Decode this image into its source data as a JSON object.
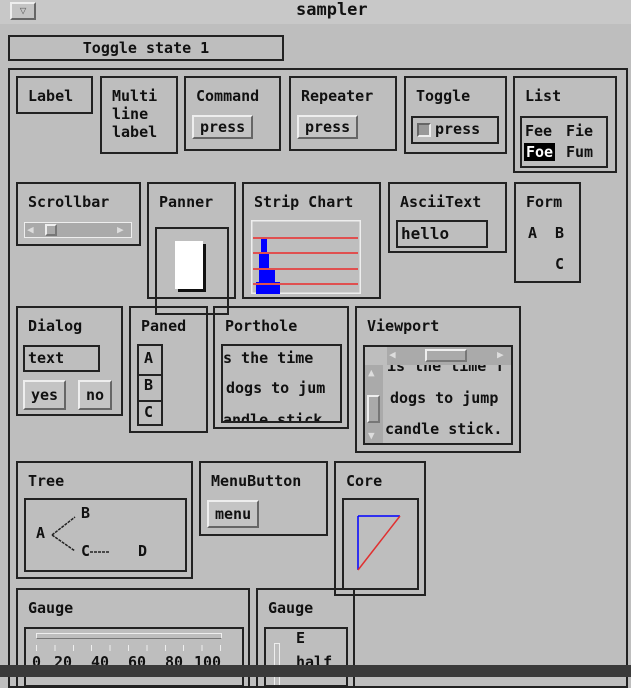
{
  "window": {
    "title": "sampler",
    "menu_icon": "triangle-down-icon"
  },
  "status_label": "Toggle state 1",
  "widgets": {
    "label": {
      "title": "Label"
    },
    "multiline": {
      "title": "Multi\nline\nlabel"
    },
    "command": {
      "title": "Command",
      "button": "press"
    },
    "repeater": {
      "title": "Repeater",
      "button": "press"
    },
    "toggle": {
      "title": "Toggle",
      "button": "press"
    },
    "list": {
      "title": "List",
      "items": [
        "Fee",
        "Fie",
        "Foe",
        "Fum"
      ],
      "selected": "Foe"
    },
    "scrollbar": {
      "title": "Scrollbar"
    },
    "panner": {
      "title": "Panner"
    },
    "stripchart": {
      "title": "Strip Chart"
    },
    "asciitext": {
      "title": "AsciiText",
      "value": "hello"
    },
    "form": {
      "title": "Form",
      "items": [
        "A",
        "B",
        "C"
      ]
    },
    "dialog": {
      "title": "Dialog",
      "value": "text",
      "yes": "yes",
      "no": "no"
    },
    "paned": {
      "title": "Paned",
      "panes": [
        "A",
        "B",
        "C"
      ]
    },
    "porthole": {
      "title": "Porthole",
      "lines": [
        "s the time",
        "dogs to jum",
        "andle stick"
      ]
    },
    "viewport": {
      "title": "Viewport",
      "lines": [
        "is the time f",
        "dogs to jump",
        "candle stick."
      ]
    },
    "tree": {
      "title": "Tree",
      "nodes": [
        "A",
        "B",
        "C",
        "D"
      ]
    },
    "menubutton": {
      "title": "MenuButton",
      "button": "menu"
    },
    "core": {
      "title": "Core"
    },
    "gauge1": {
      "title": "Gauge",
      "ticks": [
        "0",
        "20",
        "40",
        "60",
        "80",
        "100"
      ]
    },
    "gauge2": {
      "title": "Gauge",
      "ticks": [
        "E",
        "half"
      ]
    }
  },
  "colors": {
    "background": "#bebebe",
    "strip_bars": "#0000ff",
    "strip_lines": "#e05050",
    "core_blue": "#0000ff",
    "core_red": "#e03030"
  }
}
